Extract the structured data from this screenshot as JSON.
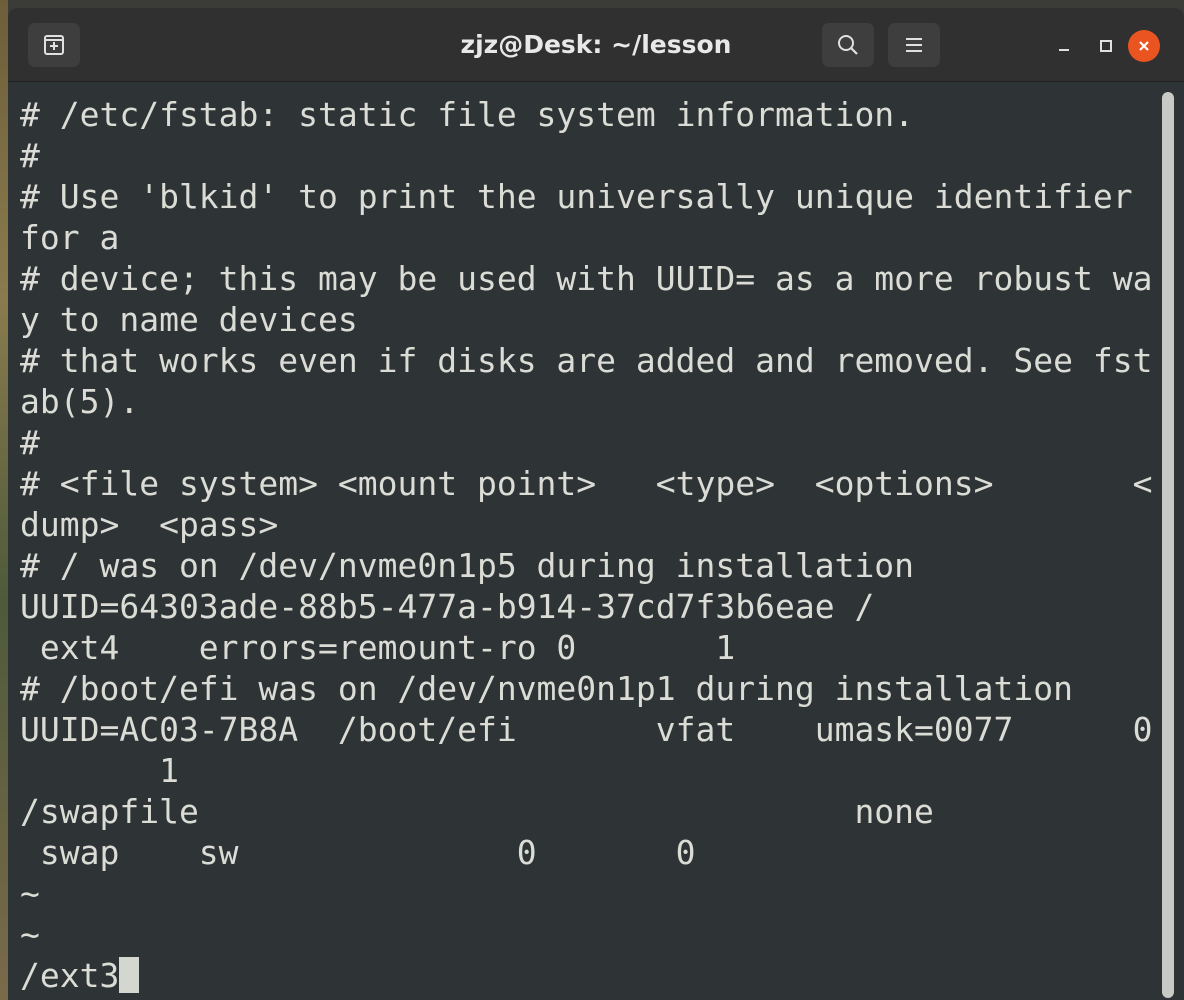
{
  "window": {
    "title": "zjz@Desk: ~/lesson"
  },
  "terminal": {
    "lines": [
      "# /etc/fstab: static file system information.",
      "#",
      "# Use 'blkid' to print the universally unique identifier",
      "for a",
      "# device; this may be used with UUID= as a more robust wa",
      "y to name devices",
      "# that works even if disks are added and removed. See fst",
      "ab(5).",
      "#",
      "# <file system> <mount point>   <type>  <options>       <",
      "dump>  <pass>",
      "# / was on /dev/nvme0n1p5 during installation",
      "UUID=64303ade-88b5-477a-b914-37cd7f3b6eae /",
      " ext4    errors=remount-ro 0       1",
      "# /boot/efi was on /dev/nvme0n1p1 during installation",
      "UUID=AC03-7B8A  /boot/efi       vfat    umask=0077      0",
      "       1",
      "/swapfile                                 none",
      " swap    sw              0       0",
      "~",
      "~"
    ],
    "command_line": "/ext3"
  },
  "colors": {
    "terminal_bg": "#2e3436",
    "terminal_fg": "#dcdcd6",
    "titlebar_bg": "#303030",
    "close_button": "#e95420"
  },
  "icons": {
    "new_tab": "new-tab-icon",
    "search": "search-icon",
    "menu": "hamburger-menu-icon",
    "minimize": "minimize-icon",
    "maximize": "maximize-icon",
    "close": "close-icon"
  }
}
